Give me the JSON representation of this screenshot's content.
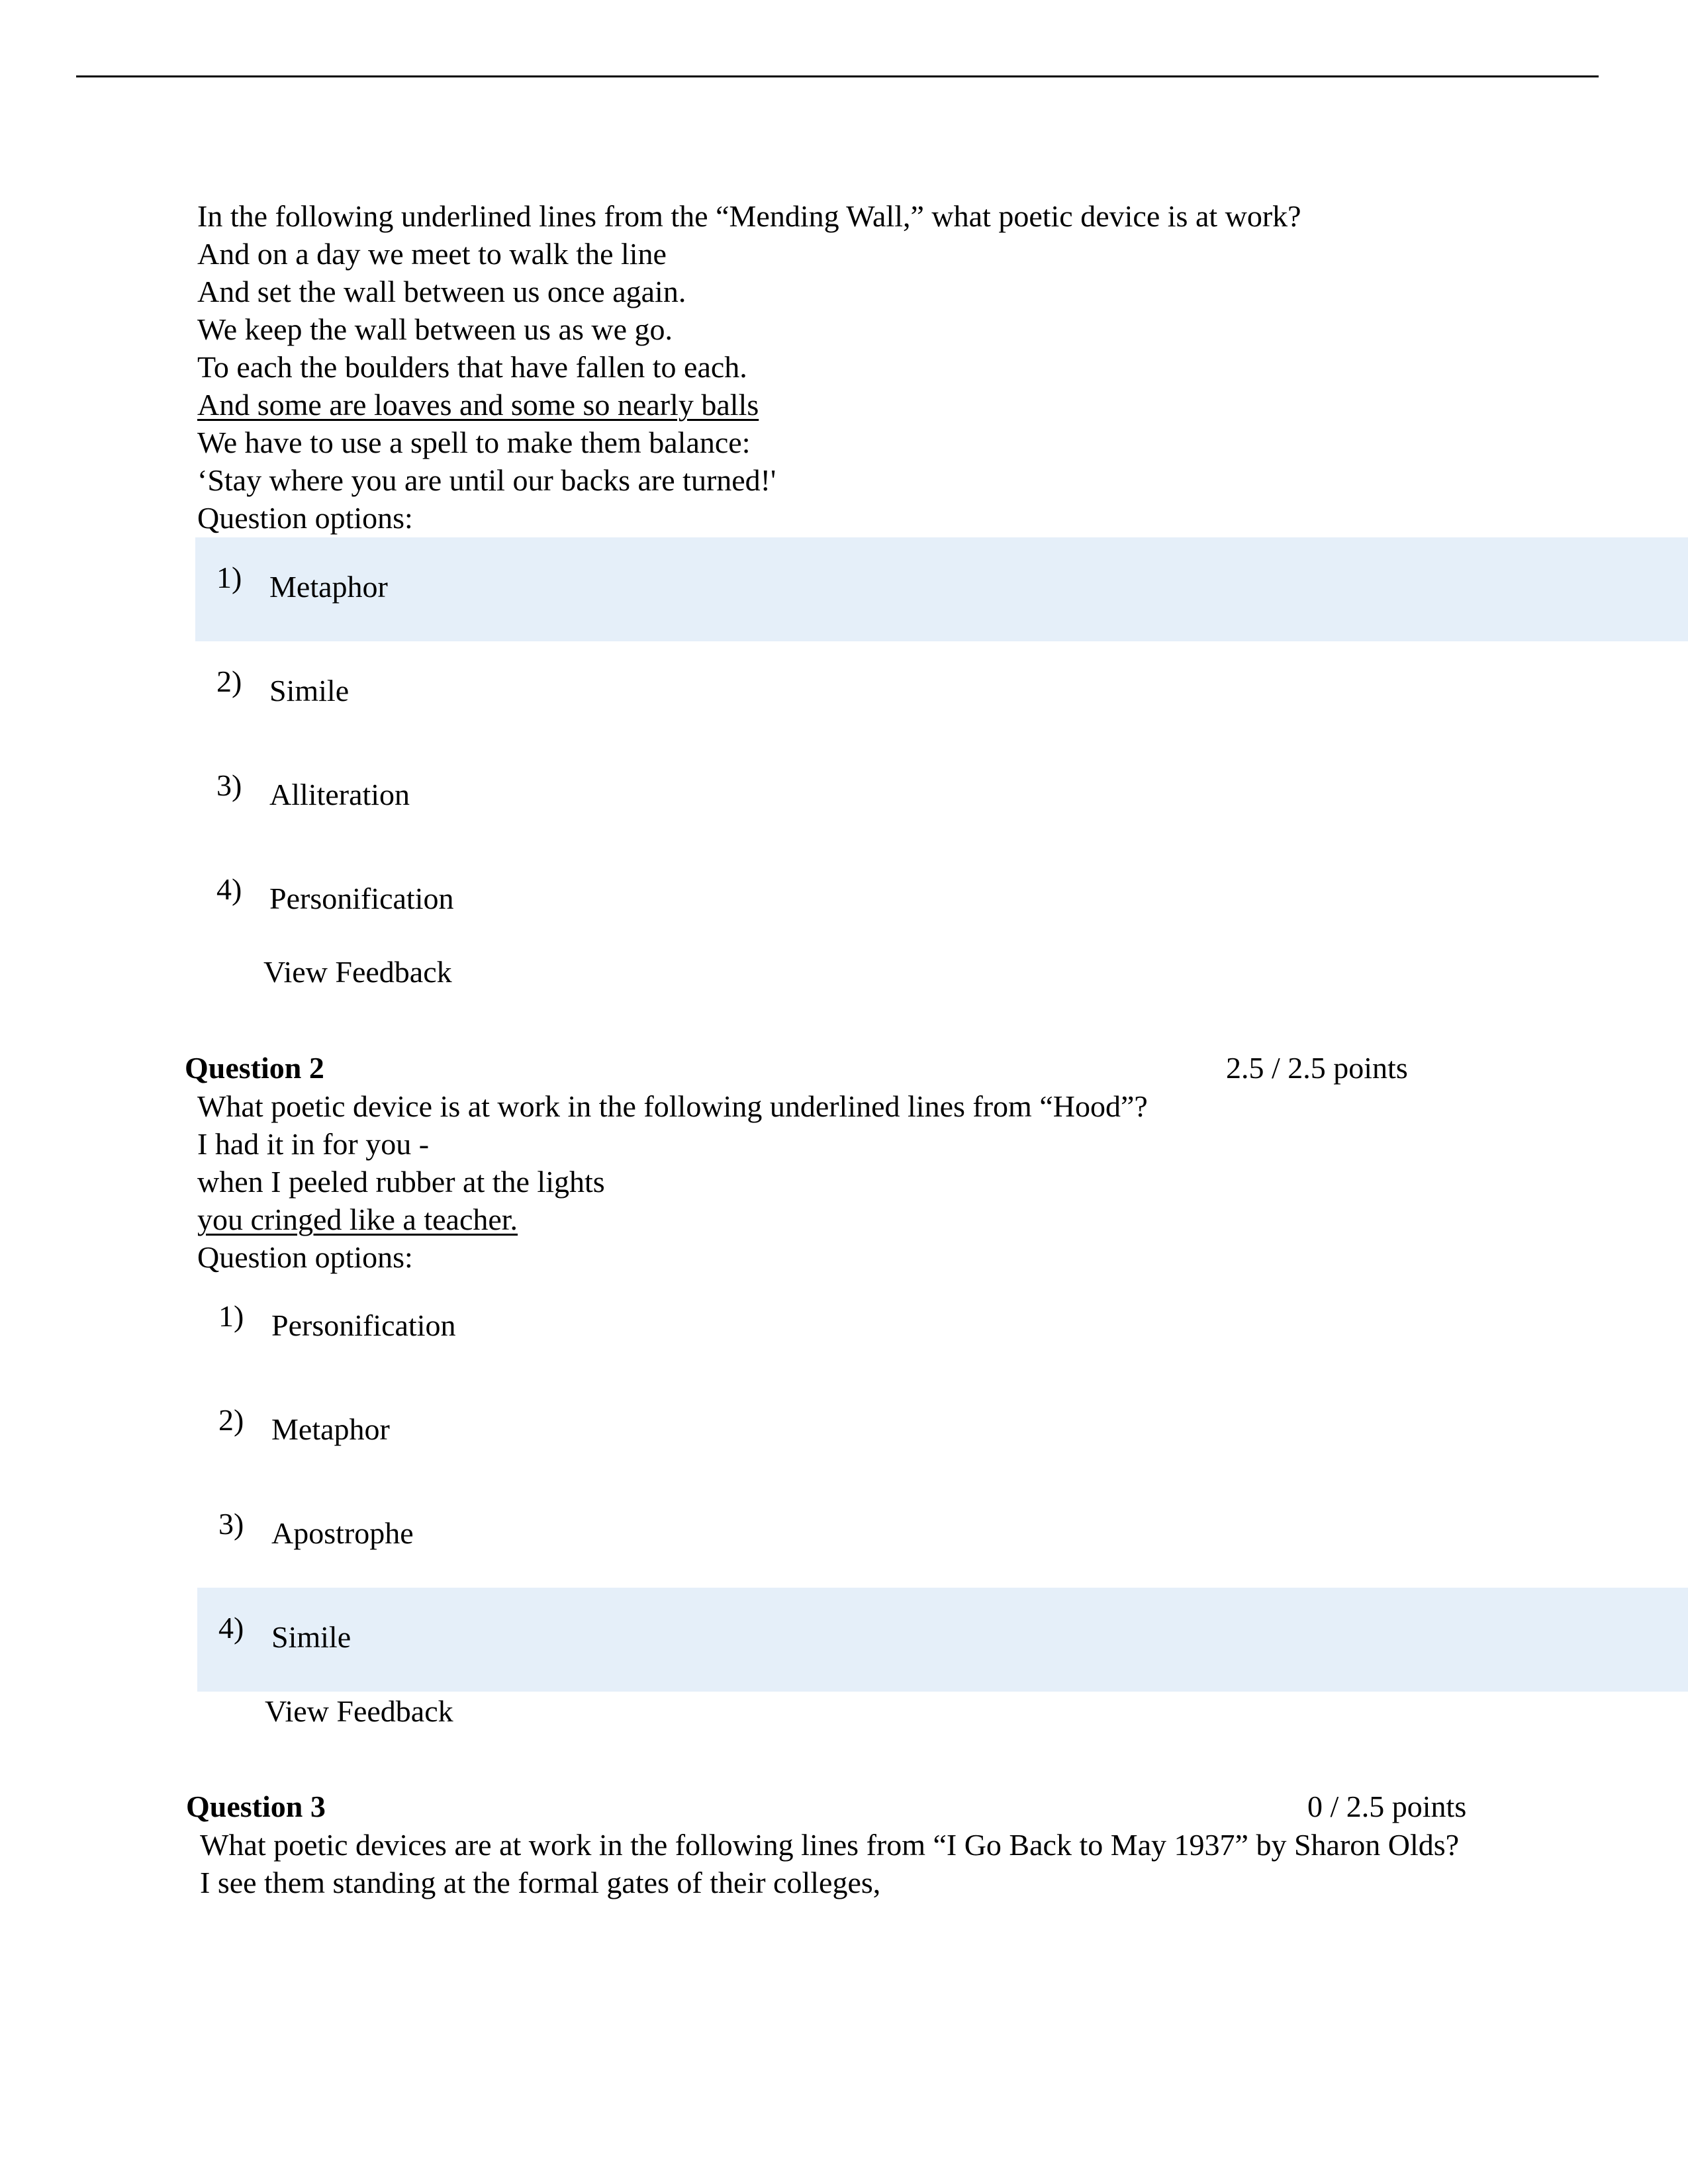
{
  "questions": [
    {
      "header": "",
      "points": "",
      "prompt": "In the following underlined lines from the “Mending Wall,” what poetic device is at work?",
      "lines": [
        {
          "text": "And on a day we meet to walk the line",
          "underlined": false
        },
        {
          "text": "And set the wall between us once again.",
          "underlined": false
        },
        {
          "text": "We keep the wall between us as we go.",
          "underlined": false
        },
        {
          "text": "To each the boulders that have fallen to each.",
          "underlined": false
        },
        {
          "text": "And some are loaves and some so nearly balls",
          "underlined": true
        },
        {
          "text": "We have to use a spell to make them balance:",
          "underlined": false
        },
        {
          "text": "‘Stay where you are until our backs are turned!'",
          "underlined": false
        }
      ],
      "options_label": "Question options:",
      "options": [
        {
          "num": "1)",
          "label": "Metaphor",
          "selected": true
        },
        {
          "num": "2)",
          "label": "Simile",
          "selected": false
        },
        {
          "num": "3)",
          "label": "Alliteration",
          "selected": false
        },
        {
          "num": "4)",
          "label": "Personification",
          "selected": false
        }
      ],
      "feedback_label": "View Feedback"
    },
    {
      "header": "Question 2",
      "points": "2.5 / 2.5 points",
      "prompt": "What poetic device is at work in the following underlined lines from “Hood”?",
      "lines": [
        {
          "text": "I had it in for you -",
          "underlined": false
        },
        {
          "text": "when I peeled rubber at the lights",
          "underlined": false
        },
        {
          "text": "you cringed like a teacher.",
          "underlined": true
        }
      ],
      "options_label": "Question options:",
      "options": [
        {
          "num": "1)",
          "label": "Personification",
          "selected": false
        },
        {
          "num": "2)",
          "label": "Metaphor",
          "selected": false
        },
        {
          "num": "3)",
          "label": "Apostrophe",
          "selected": false
        },
        {
          "num": "4)",
          "label": "Simile",
          "selected": true
        }
      ],
      "feedback_label": "View Feedback"
    },
    {
      "header": "Question 3",
      "points": "0 / 2.5 points",
      "prompt": "What poetic devices are at work in the following lines from “I Go Back to May 1937” by Sharon Olds?",
      "lines": [
        {
          "text": "I see them standing at the formal gates of their colleges,",
          "underlined": false
        }
      ]
    }
  ],
  "colors": {
    "selected_option_bg": "#e5eff9",
    "text": "#000000"
  }
}
